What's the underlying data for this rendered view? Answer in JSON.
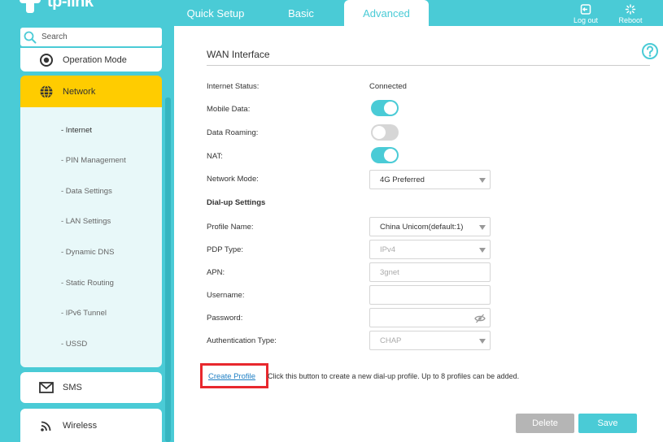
{
  "brand": {
    "name": "tp-link"
  },
  "top_tabs": [
    {
      "label": "Quick Setup"
    },
    {
      "label": "Basic"
    },
    {
      "label": "Advanced"
    }
  ],
  "top_actions": {
    "logout": "Log out",
    "reboot": "Reboot"
  },
  "sidebar": {
    "search_placeholder": "Search",
    "op_mode": "Operation Mode",
    "network": "Network",
    "network_sub": [
      "- Internet",
      "- PIN Management",
      "- Data Settings",
      "- LAN Settings",
      "- Dynamic DNS",
      "- Static Routing",
      "- IPv6 Tunnel",
      "- USSD"
    ],
    "sms": "SMS",
    "wireless": "Wireless"
  },
  "main": {
    "title": "WAN Interface",
    "internet_status_label": "Internet Status:",
    "internet_status_value": "Connected",
    "mobile_data_label": "Mobile Data:",
    "mobile_data_on": true,
    "data_roaming_label": "Data Roaming:",
    "data_roaming_on": false,
    "nat_label": "NAT:",
    "nat_on": true,
    "network_mode_label": "Network Mode:",
    "network_mode_value": "4G Preferred",
    "dialup_heading": "Dial-up Settings",
    "profile_name_label": "Profile Name:",
    "profile_name_value": "China Unicom(default:1)",
    "pdp_type_label": "PDP Type:",
    "pdp_type_value": "IPv4",
    "apn_label": "APN:",
    "apn_placeholder": "3gnet",
    "username_label": "Username:",
    "username_value": "",
    "password_label": "Password:",
    "password_value": "",
    "auth_type_label": "Authentication Type:",
    "auth_type_value": "CHAP",
    "create_profile_label": "Create Profile",
    "create_profile_hint": "Click this button to create a new dial-up profile. Up to 8 profiles can be added.",
    "delete_label": "Delete",
    "save_label": "Save"
  },
  "colors": {
    "accent": "#4acbd6",
    "active_nav": "#ffcc00",
    "highlight_box": "#e8282d",
    "link": "#1e7fc4",
    "disabled_button": "#b5b5b5"
  }
}
